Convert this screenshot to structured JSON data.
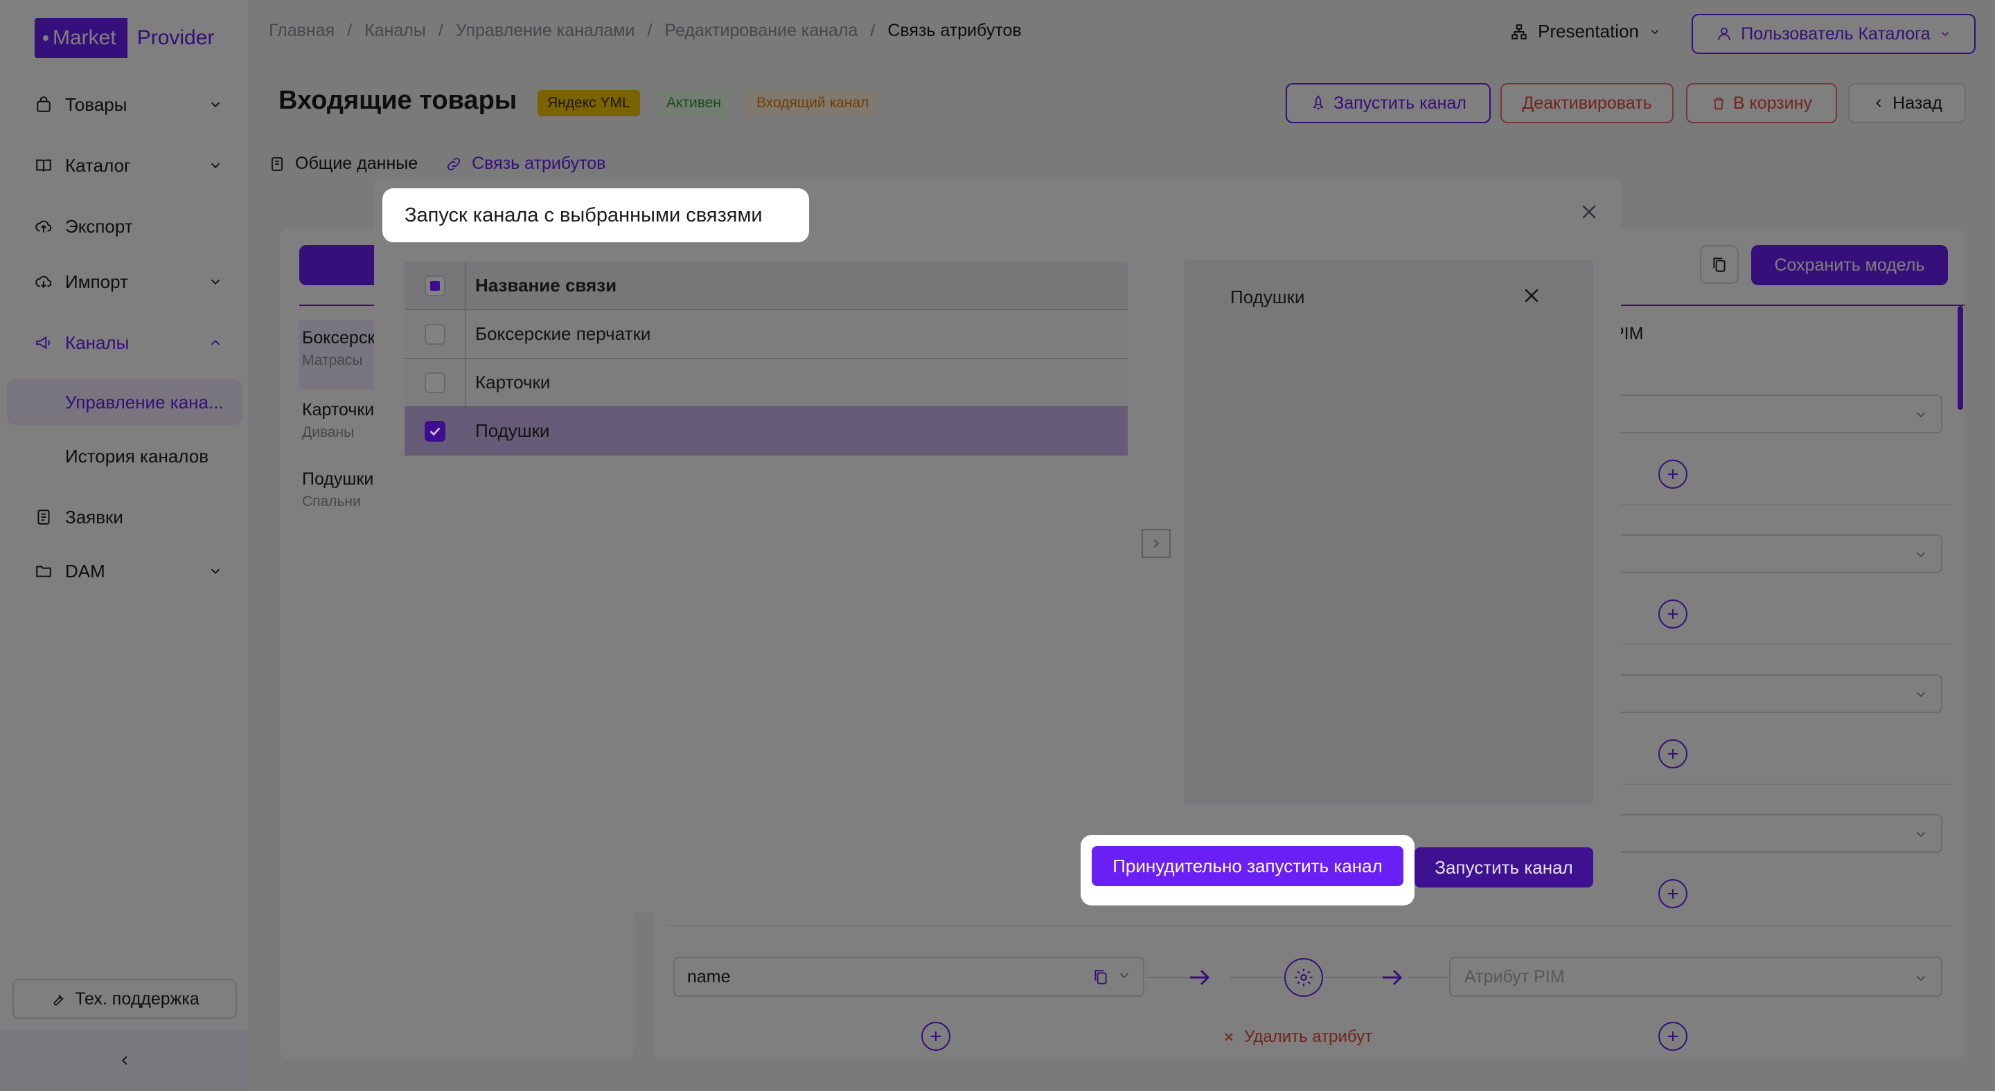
{
  "app": {
    "logo_market": "Market",
    "logo_provider": "Provider"
  },
  "sidebar": {
    "items": [
      {
        "label": "Товары",
        "icon": "bag-icon",
        "chevron": "down"
      },
      {
        "label": "Каталог",
        "icon": "book-icon",
        "chevron": "down"
      },
      {
        "label": "Экспорт",
        "icon": "cloud-upload-icon"
      },
      {
        "label": "Импорт",
        "icon": "cloud-download-icon",
        "chevron": "down"
      },
      {
        "label": "Каналы",
        "icon": "megaphone-icon",
        "chevron": "up"
      },
      {
        "label": "Управление кана..."
      },
      {
        "label": "История каналов"
      },
      {
        "label": "Заявки",
        "icon": "receipt-icon"
      },
      {
        "label": "DAM",
        "icon": "folder-icon",
        "chevron": "down"
      }
    ],
    "support_label": "Тех. поддержка"
  },
  "header": {
    "breadcrumb": [
      "Главная",
      "Каналы",
      "Управление каналами",
      "Редактирование канала",
      "Связь атрибутов"
    ],
    "breadcrumb_sep": "/",
    "presentation": "Presentation",
    "user": "Пользователь Каталога"
  },
  "page": {
    "title": "Входящие товары",
    "badges": {
      "yml": "Яндекс YML",
      "status": "Активен",
      "direction": "Входящий канал"
    },
    "buttons": {
      "launch": "Запустить канал",
      "deactivate": "Деактивировать",
      "trash": "В корзину",
      "back": "Назад"
    },
    "tabs": {
      "general": "Общие данные",
      "attributes": "Связь атрибутов"
    },
    "left_list": [
      {
        "title": "Боксерск",
        "subtitle": "Матрасы"
      },
      {
        "title": "Карточки",
        "subtitle": "Диваны"
      },
      {
        "title": "Подушки",
        "subtitle": "Спальни"
      }
    ],
    "save_model": "Сохранить модель",
    "pim_header": "PIM",
    "attribute_name": "name",
    "pim_placeholder": "Атрибут PIM",
    "delete_attribute": "Удалить атрибут"
  },
  "modal": {
    "title": "Запуск канала с выбранными связями",
    "column_header": "Название связи",
    "rows": [
      {
        "label": "Боксерские перчатки",
        "checked": false
      },
      {
        "label": "Карточки",
        "checked": false
      },
      {
        "label": "Подушки",
        "checked": true
      }
    ],
    "selected": [
      "Подушки"
    ],
    "force_launch": "Принудительно запустить канал",
    "launch": "Запустить канал"
  },
  "colors": {
    "accent": "#6a1ff5",
    "danger": "#e5483f",
    "badge_yml": "#f7c600",
    "badge_active": "#2a9d2a",
    "badge_incoming": "#e07a00"
  }
}
